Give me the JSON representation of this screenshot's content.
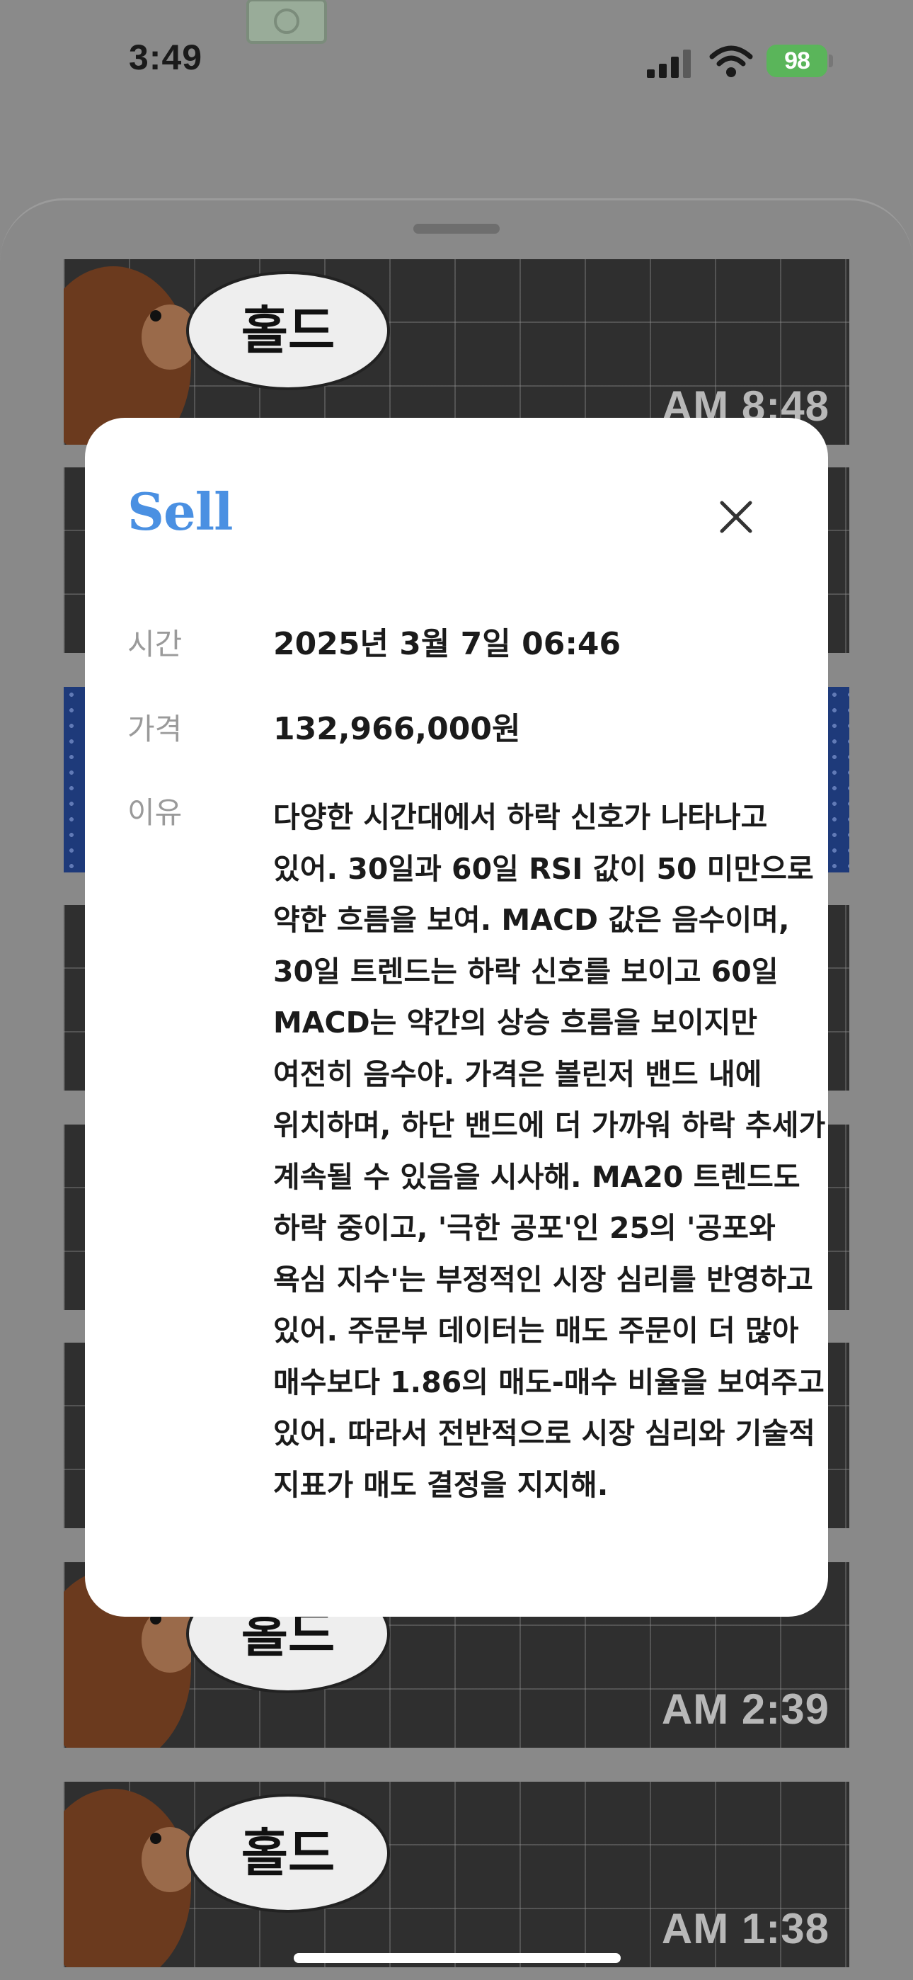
{
  "status_bar": {
    "time": "3:49",
    "battery": "98",
    "icons": [
      "signal-icon",
      "wifi-icon",
      "battery-icon"
    ]
  },
  "feed": [
    {
      "bubble": "홀드",
      "time": "AM 8:48"
    },
    {
      "bubble": "홀드",
      "time": "AM 2:39"
    },
    {
      "bubble": "홀드",
      "time": "AM 1:38"
    }
  ],
  "modal": {
    "title": "Sell",
    "close_icon": "close-icon",
    "rows": [
      {
        "label": "시간",
        "value": "2025년 3월 7일 06:46"
      },
      {
        "label": "가격",
        "value": "132,966,000원"
      },
      {
        "label": "이유",
        "value": "다양한 시간대에서 하락 신호가 나타나고 있어. 30일과 60일 RSI 값이 50 미만으로 약한 흐름을 보여. MACD 값은 음수이며, 30일 트렌드는 하락 신호를 보이고 60일 MACD는 약간의 상승 흐름을 보이지만 여전히 음수야. 가격은 볼린저 밴드 내에 위치하며, 하단 밴드에 더 가까워 하락 추세가 계속될 수 있음을 시사해. MA20 트렌드도 하락 중이고, '극한 공포'인 25의 '공포와 욕심 지수'는 부정적인 시장 심리를 반영하고 있어. 주문부 데이터는 매도 주문이 더 많아 매수보다 1.86의 매도-매수 비율을 보여주고 있어. 따라서 전반적으로 시장 심리와 기술적 지표가 매도 결정을 지지해."
      }
    ]
  },
  "colors": {
    "accent": "#4a90e2",
    "battery": "#5ab55a"
  }
}
